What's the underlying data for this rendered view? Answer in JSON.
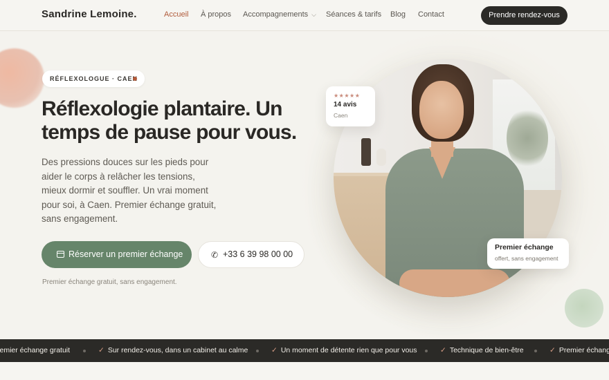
{
  "header": {
    "brand": "Sandrine Lemoine.",
    "nav": [
      {
        "label": "Accueil"
      },
      {
        "label": "À propos"
      },
      {
        "label": "Accompagnements"
      },
      {
        "label": "Séances & tarifs"
      },
      {
        "label": "Blog"
      },
      {
        "label": "Contact"
      }
    ],
    "cta": "Prendre rendez-vous"
  },
  "hero": {
    "badge": "RÉFLEXOLOGUE · CAEN",
    "headline_line1": "Réflexologie plantaire. Un",
    "headline_line2": "temps de pause pour vous.",
    "lead": "Des pressions douces sur les pieds pour aider le corps à relâcher les tensions, mieux dormir et souffler. Un vrai moment pour soi, à Caen. Premier échange gratuit, sans engagement.",
    "primary_button": "Réserver un premier échange",
    "phone_button": "+33 6 39 98 00 00",
    "note": "Premier échange gratuit, sans engagement."
  },
  "reviews_card": {
    "stars": "★★★★★",
    "count": "14 avis",
    "city": "Caen"
  },
  "offer_card": {
    "title": "Premier échange",
    "subtitle": "offert, sans engagement"
  },
  "ticker": {
    "items": [
      "remier échange gratuit",
      "Sur rendez-vous, dans un cabinet au calme",
      "Un moment de détente rien que pour vous",
      "Technique de bien-être",
      "Premier échange"
    ],
    "check": "✓"
  },
  "colors": {
    "accent": "#b05a3a",
    "primary_green": "#66856a",
    "dark": "#2b2a27",
    "background": "#f4f3ee"
  }
}
